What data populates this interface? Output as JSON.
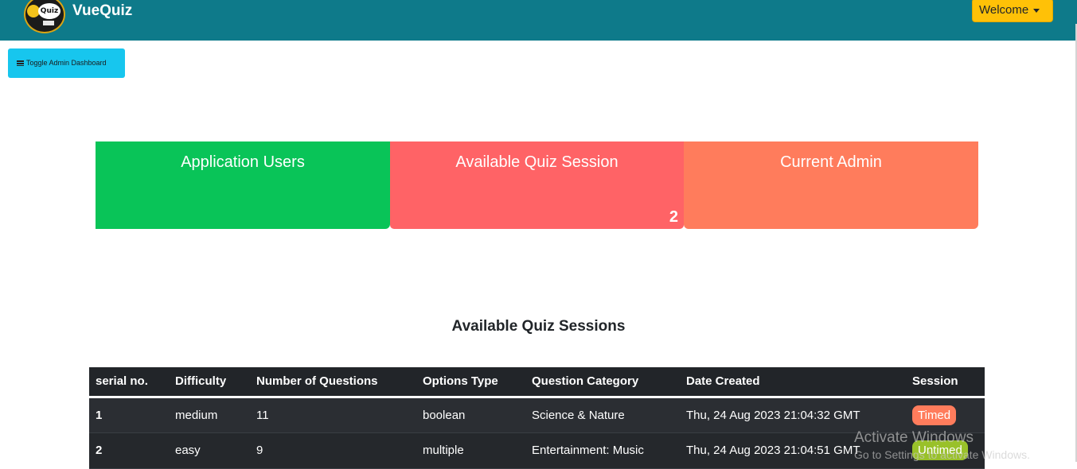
{
  "navbar": {
    "logo_text": "Quiz",
    "brand": "VueQuiz",
    "welcome_label": "Welcome"
  },
  "toolbar": {
    "toggle_label": "Toggle Admin Dashboard"
  },
  "cards": {
    "users": {
      "title": "Application Users",
      "count": ""
    },
    "sessions": {
      "title": "Available Quiz Session",
      "count": "2"
    },
    "admin": {
      "title": "Current Admin",
      "count": ""
    }
  },
  "section": {
    "title": "Available Quiz Sessions"
  },
  "table": {
    "headers": [
      "serial no.",
      "Difficulty",
      "Number of Questions",
      "Options Type",
      "Question Category",
      "Date Created",
      "Session"
    ],
    "rows": [
      {
        "serial": "1",
        "difficulty": "medium",
        "questions": "11",
        "options_type": "boolean",
        "category": "Science & Nature",
        "date": "Thu, 24 Aug 2023 21:04:32 GMT",
        "session": "Timed"
      },
      {
        "serial": "2",
        "difficulty": "easy",
        "questions": "9",
        "options_type": "multiple",
        "category": "Entertainment: Music",
        "date": "Thu, 24 Aug 2023 21:04:51 GMT",
        "session": "Untimed"
      }
    ]
  },
  "watermark": {
    "line1": "Activate Windows",
    "line2": "Go to Settings to activate Windows."
  },
  "colors": {
    "navbar": "#0e7a8a",
    "users_card": "#09c458",
    "sessions_card": "#ff6366",
    "admin_card": "#ff7c5c",
    "welcome_button": "#ffc107",
    "toggle_button": "#17c6ee",
    "timed_badge": "#ff7c5c",
    "untimed_badge": "#99c12a"
  }
}
